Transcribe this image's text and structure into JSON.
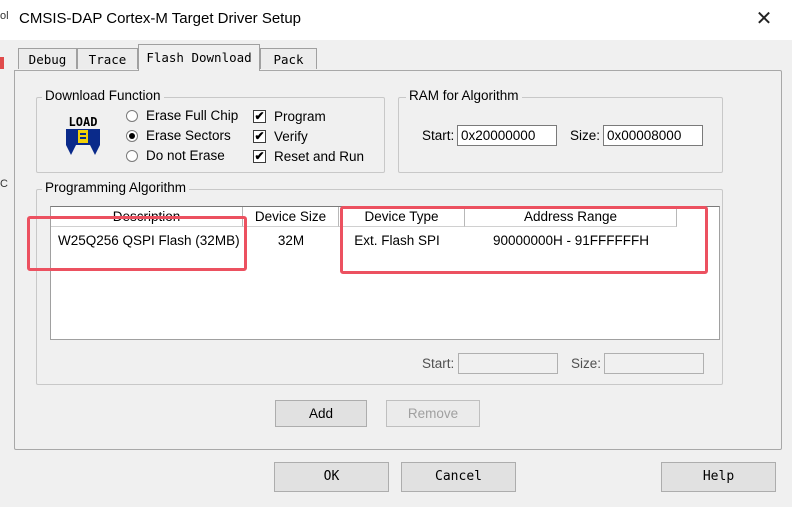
{
  "window": {
    "title": "CMSIS-DAP Cortex-M Target Driver Setup",
    "close_glyph": "✕"
  },
  "edge_fragments": [
    "ol",
    "C"
  ],
  "tabs": [
    {
      "label": "Debug",
      "active": false
    },
    {
      "label": "Trace",
      "active": false
    },
    {
      "label": "Flash Download",
      "active": true
    },
    {
      "label": "Pack",
      "active": false
    }
  ],
  "download_function": {
    "legend": "Download Function",
    "icon": "load-icon",
    "icon_text": "LOAD",
    "radios": [
      {
        "label": "Erase Full Chip",
        "checked": false
      },
      {
        "label": "Erase Sectors",
        "checked": true
      },
      {
        "label": "Do not Erase",
        "checked": false
      }
    ],
    "checkboxes": [
      {
        "label": "Program",
        "checked": true
      },
      {
        "label": "Verify",
        "checked": true
      },
      {
        "label": "Reset and Run",
        "checked": true
      }
    ]
  },
  "ram": {
    "legend": "RAM for Algorithm",
    "start_label": "Start:",
    "start_value": "0x20000000",
    "size_label": "Size:",
    "size_value": "0x00008000"
  },
  "programming_algorithm": {
    "legend": "Programming Algorithm",
    "columns": [
      "Description",
      "Device Size",
      "Device Type",
      "Address Range"
    ],
    "rows": [
      {
        "description": "W25Q256 QSPI Flash (32MB)",
        "size": "32M",
        "type": "Ext. Flash SPI",
        "range": "90000000H - 91FFFFFFH"
      }
    ],
    "start_label": "Start:",
    "start_value": "",
    "size_label": "Size:",
    "size_value": "",
    "add_label": "Add",
    "remove_label": "Remove"
  },
  "footer": {
    "ok_label": "OK",
    "cancel_label": "Cancel",
    "help_label": "Help"
  },
  "colors": {
    "highlight": "#ec5160",
    "tick": "✔"
  }
}
